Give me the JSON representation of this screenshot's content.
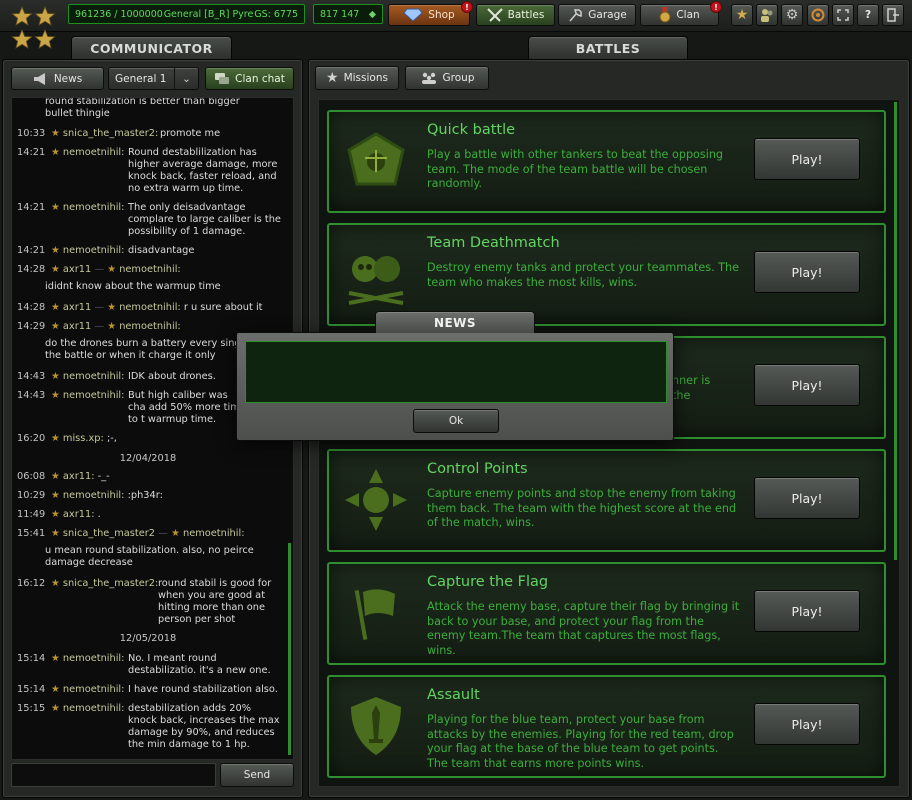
{
  "top_bar": {
    "experience": "961236 / 1000000",
    "rank_name": "General [B_R] Pyre",
    "gear_score": "GS: 6775",
    "crystals": "817 147",
    "shop_label": "Shop",
    "battles_label": "Battles",
    "garage_label": "Garage",
    "clan_label": "Clan",
    "notification_mark": "!",
    "help_label": "?"
  },
  "communicator": {
    "title": "COMMUNICATOR",
    "news_tab": "News",
    "channel": "General 1",
    "clan_chat_tab": "Clan chat",
    "send_label": "Send",
    "input_value": ""
  },
  "battles": {
    "title": "BATTLES",
    "missions_tab": "Missions",
    "group_tab": "Group",
    "play_label": "Play!",
    "modes": [
      {
        "title": "Quick battle",
        "desc": "Play a battle with other tankers to beat the opposing team. The mode of the team battle will be chosen randomly."
      },
      {
        "title": "Team Deathmatch",
        "desc": "Destroy enemy tanks and protect your teammates. The team who makes the most kills, wins."
      },
      {
        "title": "",
        "desc": "nner is the"
      },
      {
        "title": "Control Points",
        "desc": "Capture enemy points and stop the enemy from taking them back. The team with the highest score at the end of the match, wins."
      },
      {
        "title": "Capture the Flag",
        "desc": "Attack the enemy base, capture their flag by bringing it back to your base, and protect your flag from the enemy team.The team that captures the most flags, wins."
      },
      {
        "title": "Assault",
        "desc": "Playing for the blue team, protect your base from attacks by the enemies. Playing for the red team, drop your flag at the base of the blue team to get points. The team that earns more points wins."
      }
    ]
  },
  "chat": {
    "messages": [
      {
        "time": "",
        "from": "",
        "to": "",
        "text": "round stabilization is better than bigger bullet thingie"
      },
      {
        "time": "10:33",
        "from": "snica_the_master2:",
        "to": "",
        "text": "promote me"
      },
      {
        "time": "14:21",
        "from": "nemoetnihil:",
        "to": "",
        "text": "Round destablilization has higher average damage, more knock back, faster reload, and no extra warm up time."
      },
      {
        "time": "14:21",
        "from": "nemoetnihil:",
        "to": "",
        "text": "The only deisadvantage complare to large caliber is the possibility of 1 damage."
      },
      {
        "time": "14:21",
        "from": "nemoetnihil:",
        "to": "",
        "text": "disadvantage"
      },
      {
        "time": "14:28",
        "from": "axr11",
        "to": "nemoetnihil:",
        "text": "ididnt know about the warmup time"
      },
      {
        "time": "14:28",
        "from": "axr11",
        "to": "nemoetnihil:",
        "text": "r u sure about it"
      },
      {
        "time": "14:29",
        "from": "axr11",
        "to": "nemoetnihil:",
        "text": "do the drones burn a battery every single r of the battle or when it charge it only"
      },
      {
        "time": "14:43",
        "from": "nemoetnihil:",
        "to": "",
        "text": "IDK about drones."
      },
      {
        "time": "14:43",
        "from": "nemoetnihil:",
        "to": "",
        "text": "But high caliber was cha add 50% more time to t warmup time."
      },
      {
        "time": "16:20",
        "from": "miss.xp:",
        "to": "",
        "text": ";-,"
      },
      {
        "time": "06:08",
        "from": "axr11:",
        "to": "",
        "text": "-_-"
      },
      {
        "time": "10:29",
        "from": "nemoetnihil:",
        "to": "",
        "text": ":ph34r:"
      },
      {
        "time": "11:49",
        "from": "axr11:",
        "to": "",
        "text": "."
      },
      {
        "time": "15:41",
        "from": "snica_the_master2",
        "to": "nemoetnihil:",
        "text": "u mean round stabilization. also, no peirce damage decrease"
      },
      {
        "time": "16:12",
        "from": "snica_the_master2:",
        "to": "",
        "text": "round stabil is good for when you are good at hitting more than one person per shot"
      },
      {
        "time": "15:14",
        "from": "nemoetnihil:",
        "to": "",
        "text": "No. I meant round destabilizatio. it's a new one."
      },
      {
        "time": "15:14",
        "from": "nemoetnihil:",
        "to": "",
        "text": "I have round stabilization also."
      },
      {
        "time": "15:15",
        "from": "nemoetnihil:",
        "to": "",
        "text": "destabilization adds 20% knock back, increases the max damage by 90%, and reduces the min damage to 1 hp."
      }
    ],
    "dates": [
      "12/04/2018",
      "12/05/2018"
    ]
  },
  "news_dialog": {
    "title": "NEWS",
    "content": "",
    "ok_label": "Ok"
  },
  "colors": {
    "accent_green": "#2f8f2f",
    "title_green": "#63d463",
    "text_green": "#3cae3c",
    "badge_red": "#c0141a"
  },
  "icons": [
    "star-icon",
    "crystal-icon",
    "battles-icon",
    "garage-icon",
    "clan-medal-icon",
    "megaphone-icon",
    "chat-icon",
    "group-icon",
    "settings-icon",
    "sound-icon",
    "fullscreen-icon"
  ]
}
